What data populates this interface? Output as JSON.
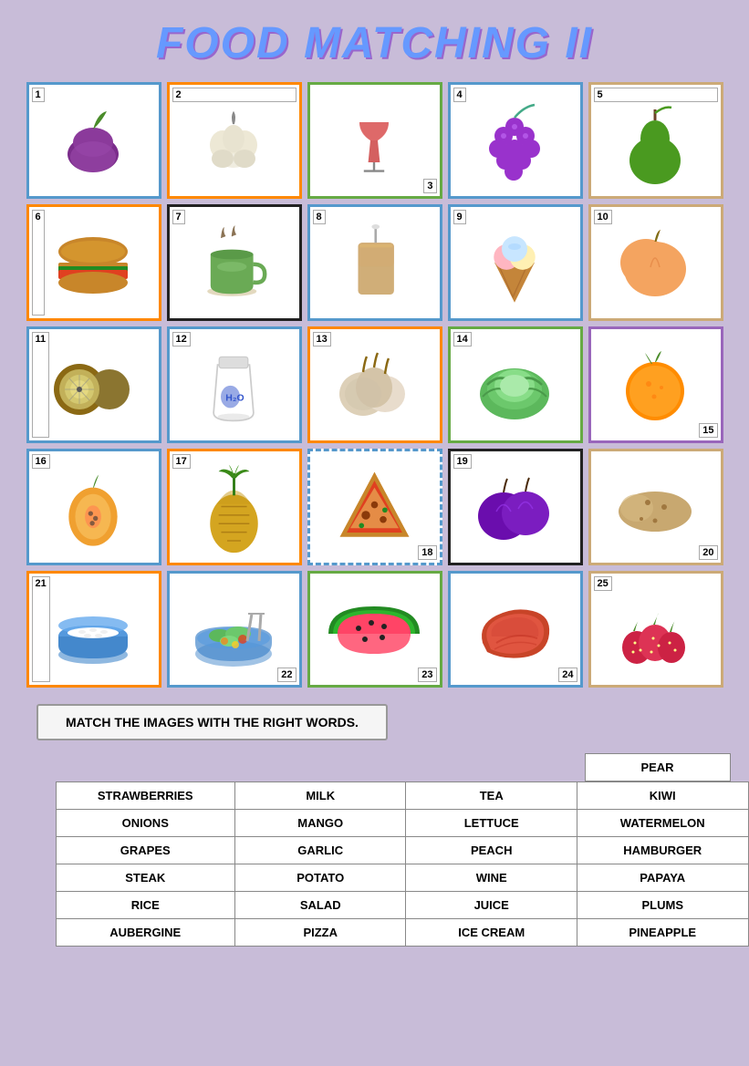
{
  "title": "FOOD MATCHING II",
  "cells": [
    {
      "num": "1",
      "food": "aubergine",
      "label": "Aubergine",
      "border": "border-blue",
      "numPos": "tl"
    },
    {
      "num": "2",
      "food": "garlic",
      "label": "Garlic",
      "border": "border-orange",
      "numPos": "tr"
    },
    {
      "num": "3",
      "food": "wine",
      "label": "Wine glass",
      "border": "border-green",
      "numPos": "br"
    },
    {
      "num": "4",
      "food": "grapes",
      "label": "Grapes",
      "border": "border-blue",
      "numPos": "tl"
    },
    {
      "num": "5",
      "food": "pear",
      "label": "Pear",
      "border": "border-tan",
      "numPos": "tr"
    },
    {
      "num": "6",
      "food": "hamburger",
      "label": "Hamburger",
      "border": "border-orange",
      "numPos": "bl"
    },
    {
      "num": "7",
      "food": "tea",
      "label": "Tea",
      "border": "border-black",
      "numPos": "tl"
    },
    {
      "num": "8",
      "food": "juice",
      "label": "Juice",
      "border": "border-blue",
      "numPos": "tl"
    },
    {
      "num": "9",
      "food": "icecream",
      "label": "Ice cream",
      "border": "border-blue",
      "numPos": "tl"
    },
    {
      "num": "10",
      "food": "peach",
      "label": "Peach",
      "border": "border-tan",
      "numPos": "tl"
    },
    {
      "num": "11",
      "food": "kiwi",
      "label": "Kiwi",
      "border": "border-blue",
      "numPos": "bl"
    },
    {
      "num": "12",
      "food": "milk",
      "label": "Milk",
      "border": "border-blue",
      "numPos": "tl"
    },
    {
      "num": "13",
      "food": "onions",
      "label": "Onions",
      "border": "border-orange",
      "numPos": "tl"
    },
    {
      "num": "14",
      "food": "lettuce",
      "label": "Lettuce",
      "border": "border-green",
      "numPos": "tl"
    },
    {
      "num": "15",
      "food": "orange",
      "label": "Orange",
      "border": "border-purple",
      "numPos": "br"
    },
    {
      "num": "16",
      "food": "papaya",
      "label": "Papaya",
      "border": "border-blue",
      "numPos": "tl"
    },
    {
      "num": "17",
      "food": "pineapple",
      "label": "Pineapple",
      "border": "border-orange",
      "numPos": "tl"
    },
    {
      "num": "18",
      "food": "pizza",
      "label": "Pizza",
      "border": "border-dashed-blue",
      "numPos": "br"
    },
    {
      "num": "19",
      "food": "plums",
      "label": "Plums",
      "border": "border-black",
      "numPos": "tl"
    },
    {
      "num": "20",
      "food": "potato",
      "label": "Potato",
      "border": "border-tan",
      "numPos": "br"
    },
    {
      "num": "21",
      "food": "rice",
      "label": "Rice",
      "border": "border-orange",
      "numPos": "bl"
    },
    {
      "num": "22",
      "food": "salad",
      "label": "Salad",
      "border": "border-blue",
      "numPos": "br"
    },
    {
      "num": "23",
      "food": "watermelon",
      "label": "Watermelon",
      "border": "border-green",
      "numPos": "br"
    },
    {
      "num": "24",
      "food": "steak",
      "label": "Steak",
      "border": "border-blue",
      "numPos": "br"
    },
    {
      "num": "25",
      "food": "strawberries",
      "label": "Strawberries",
      "border": "border-tan",
      "numPos": "tl"
    }
  ],
  "instruction": "MATCH THE IMAGES WITH THE RIGHT WORDS.",
  "word_rows": [
    [
      "STRAWBERRIES",
      "MILK",
      "TEA",
      "KIWI"
    ],
    [
      "ONIONS",
      "MANGO",
      "LETTUCE",
      "WATERMELON"
    ],
    [
      "GRAPES",
      "GARLIC",
      "PEACH",
      "HAMBURGER"
    ],
    [
      "STEAK",
      "POTATO",
      "WINE",
      "PAPAYA"
    ],
    [
      "RICE",
      "SALAD",
      "JUICE",
      "PLUMS"
    ],
    [
      "AUBERGINE",
      "PIZZA",
      "ICE CREAM",
      "PINEAPPLE"
    ]
  ],
  "pear_label": "PEAR"
}
